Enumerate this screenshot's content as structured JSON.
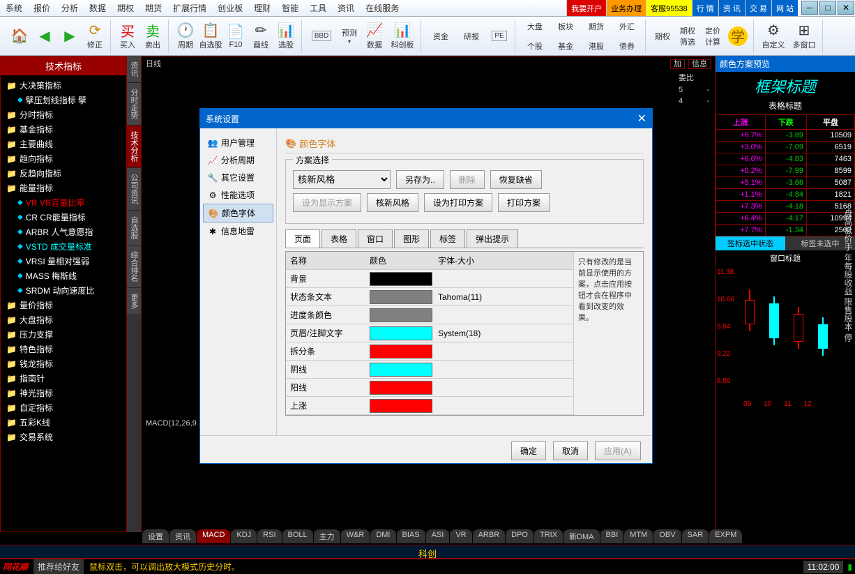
{
  "menubar": {
    "items": [
      "系统",
      "报价",
      "分析",
      "数据",
      "期权",
      "期货",
      "扩展行情",
      "创业板",
      "理财",
      "智能",
      "工具",
      "资讯",
      "在线服务"
    ],
    "right": {
      "kaifu": "我要开户",
      "yewu": "业务办理",
      "kefu": "客服95538",
      "hangqing": "行 情",
      "zixun": "资 讯",
      "jiaoyi": "交 易",
      "wangzhan": "网 站"
    }
  },
  "toolbar": {
    "xiuzheng": "修正",
    "mairu": "买入",
    "maichu": "卖出",
    "zhouqi": "周期",
    "zixuangu": "自选股",
    "f10": "F10",
    "huaxian": "画线",
    "xuangu": "选股",
    "bbd": "BBD",
    "yuce": "预测",
    "shuju": "数据",
    "kechuangban": "科创板",
    "zijin": "资金",
    "yanbao": "研报",
    "pe": "PE",
    "dapan": "大盘",
    "bankuai": "板块",
    "qihuo": "期货",
    "waihui": "外汇",
    "gegu": "个股",
    "jijin": "基金",
    "ganggu": "港股",
    "zhaiquan": "债券",
    "qiquan": "期权",
    "qiquan_shaixuan": "期权\n筛选",
    "dingjia_jisuan": "定价\n计算",
    "xue": "学",
    "zidingyi": "自定义",
    "duochuangkou": "多窗口"
  },
  "sidebar": {
    "title": "技术指标",
    "items": [
      {
        "label": "大决策指标",
        "type": "folder"
      },
      {
        "label": "擘压划线指标 擘",
        "type": "leaf",
        "indent": 1
      },
      {
        "label": "分时指标",
        "type": "folder"
      },
      {
        "label": "基金指标",
        "type": "folder"
      },
      {
        "label": "主要曲线",
        "type": "folder"
      },
      {
        "label": "趋向指标",
        "type": "folder"
      },
      {
        "label": "反趋向指标",
        "type": "folder"
      },
      {
        "label": "能量指标",
        "type": "folder",
        "open": true
      },
      {
        "label": "VR VR容量比率",
        "type": "leaf",
        "indent": 1,
        "sel": true
      },
      {
        "label": "CR CR能量指标",
        "type": "leaf",
        "indent": 1
      },
      {
        "label": "ARBR 人气意愿指",
        "type": "leaf",
        "indent": 1
      },
      {
        "label": "VSTD 成交量标准",
        "type": "leaf",
        "indent": 1,
        "cls": "cyan"
      },
      {
        "label": "VRSI 量相对强弱",
        "type": "leaf",
        "indent": 1
      },
      {
        "label": "MASS 梅斯线",
        "type": "leaf",
        "indent": 1
      },
      {
        "label": "SRDM 动向速度比",
        "type": "leaf",
        "indent": 1
      },
      {
        "label": "量价指标",
        "type": "folder"
      },
      {
        "label": "大盘指标",
        "type": "folder"
      },
      {
        "label": "压力支撑",
        "type": "folder"
      },
      {
        "label": "特色指标",
        "type": "folder"
      },
      {
        "label": "钱龙指标",
        "type": "folder"
      },
      {
        "label": "指南针",
        "type": "folder"
      },
      {
        "label": "神光指标",
        "type": "folder"
      },
      {
        "label": "自定指标",
        "type": "folder"
      },
      {
        "label": "五彩K线",
        "type": "folder"
      },
      {
        "label": "交易系统",
        "type": "folder",
        "cls": "red"
      }
    ]
  },
  "vtabs": [
    "资讯",
    "分时走势",
    "技术分析",
    "公司资讯",
    "自选股",
    "综合排名",
    "更多"
  ],
  "vtab_active": 2,
  "chart": {
    "topleft": "日线",
    "topright_jia": "加",
    "topright_info": "信息",
    "macd_label": "MACD(12,26,9"
  },
  "right_info": {
    "weibi": "委比",
    "row5": "5",
    "row4": "4",
    "dash": "-"
  },
  "preview": {
    "header": "颜色方案预览",
    "frame_title": "框架标题",
    "table_title": "表格标题",
    "headers": [
      "上涨",
      "下跌",
      "平盘"
    ],
    "rows": [
      {
        "up": "+6.7%",
        "down": "-3.89",
        "val": "10509"
      },
      {
        "up": "+3.0%",
        "down": "-7.09",
        "val": "6519"
      },
      {
        "up": "+6.6%",
        "down": "-4.83",
        "val": "7463"
      },
      {
        "up": "+0.2%",
        "down": "-7.99",
        "val": "8599"
      },
      {
        "up": "+5.1%",
        "down": "-3.66",
        "val": "5087"
      },
      {
        "up": "+1.1%",
        "down": "-4.84",
        "val": "1821"
      },
      {
        "up": "+7.3%",
        "down": "-4.18",
        "val": "5168"
      },
      {
        "up": "+6.4%",
        "down": "-4.17",
        "val": "10994"
      },
      {
        "up": "+7.7%",
        "down": "-1.34",
        "val": "2502"
      }
    ],
    "tag_sel": "签标选中状态",
    "tag_unsel": "标签未选中",
    "window_title": "窗口标题",
    "ylabels": [
      "11.38",
      "10.66",
      "9.94",
      "9.22",
      "8.50"
    ],
    "xlabels": [
      "09",
      "10",
      "11",
      "12"
    ],
    "side_text": "盘高低价手 年每股收益 限售股本 停"
  },
  "dialog": {
    "title": "系统设置",
    "nav": [
      "用户管理",
      "分析周期",
      "其它设置",
      "性能选项",
      "颜色字体",
      "信息地雷"
    ],
    "nav_active": 4,
    "section_title": "颜色字体",
    "scheme_label": "方案选择",
    "scheme_value": "核新风格",
    "btn_saveas": "另存为..",
    "btn_delete": "删除",
    "btn_restore": "恢复缺省",
    "btn_display": "设为显示方案",
    "btn_display_name": "核新风格",
    "btn_print": "设为打印方案",
    "btn_print_name": "打印方案",
    "subtabs": [
      "页面",
      "表格",
      "窗口",
      "图形",
      "标签",
      "弹出提示"
    ],
    "subtab_active": 0,
    "table_headers": {
      "name": "名称",
      "color": "颜色",
      "font": "字体-大小"
    },
    "color_rows": [
      {
        "name": "背景",
        "color": "#000000",
        "font": ""
      },
      {
        "name": "状态条文本",
        "color": "#808080",
        "font": "Tahoma(11)"
      },
      {
        "name": "进度条颜色",
        "color": "#808080",
        "font": ""
      },
      {
        "name": "页眉/注脚文字",
        "color": "#00ffff",
        "font": "System(18)"
      },
      {
        "name": "拆分条",
        "color": "#ff0000",
        "font": ""
      },
      {
        "name": "阴线",
        "color": "#00ffff",
        "font": ""
      },
      {
        "name": "阳线",
        "color": "#ff0000",
        "font": ""
      },
      {
        "name": "上涨",
        "color": "#ff0000",
        "font": ""
      }
    ],
    "note": "只有修改的是当前显示使用的方案，点击应用按钮才会在程序中看到改变的效果。",
    "btn_ok": "确定",
    "btn_cancel": "取消",
    "btn_apply": "应用(A)"
  },
  "bottom_tabs": [
    "设置",
    "资讯",
    "MACD",
    "KDJ",
    "RSI",
    "BOLL",
    "主力",
    "W&R",
    "DMI",
    "BIAS",
    "ASI",
    "VR",
    "ARBR",
    "DPO",
    "TRIX",
    "新DMA",
    "BBI",
    "MTM",
    "OBV",
    "SAR",
    "EXPM"
  ],
  "bottom_active": 2,
  "kc_bar": "科创",
  "status": {
    "logo": "同花顺",
    "rec": "推荐给好友",
    "tip": "鼠标双击，可以调出放大模式历史分时。",
    "time": "11:02:00"
  }
}
